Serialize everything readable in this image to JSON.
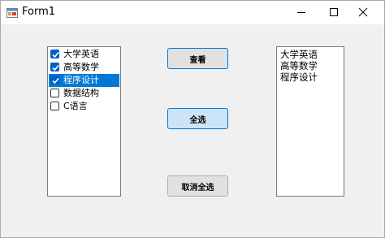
{
  "window": {
    "title": "Form1",
    "icons": {
      "app": "winforms-app-icon",
      "minimize": "minimize-icon",
      "maximize": "maximize-icon",
      "close": "close-icon"
    }
  },
  "checklist": {
    "items": [
      {
        "label": "大学英语",
        "checked": true,
        "selected": false
      },
      {
        "label": "高等数学",
        "checked": true,
        "selected": false
      },
      {
        "label": "程序设计",
        "checked": true,
        "selected": true
      },
      {
        "label": "数据结构",
        "checked": false,
        "selected": false
      },
      {
        "label": "C语言",
        "checked": false,
        "selected": false
      }
    ]
  },
  "buttons": {
    "view": "查看",
    "select_all": "全选",
    "cancel_all": "取消全选"
  },
  "output": {
    "items": [
      "大学英语",
      "高等数学",
      "程序设计"
    ]
  },
  "colors": {
    "selection": "#0078d7",
    "checkbox_checked": "#0060c0"
  }
}
